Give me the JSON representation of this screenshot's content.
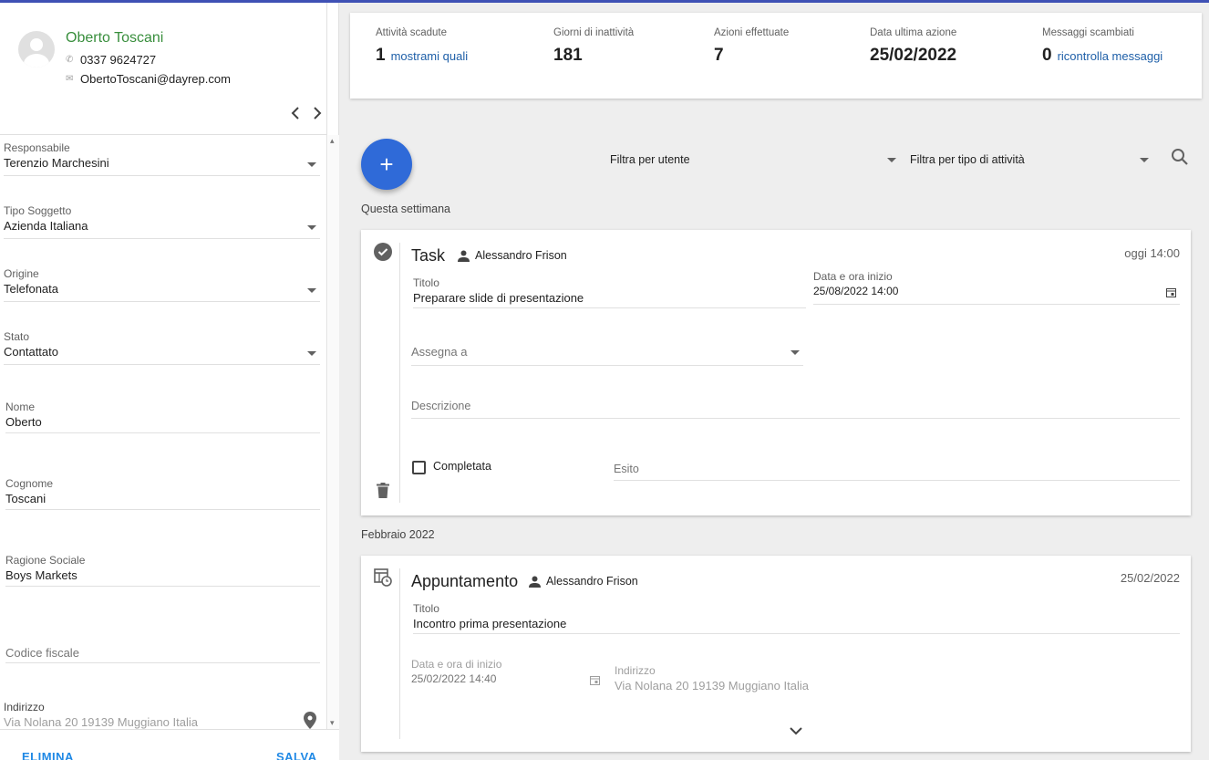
{
  "contact": {
    "name": "Oberto Toscani",
    "phone": "0337 9624727",
    "email": "ObertoToscani@dayrep.com"
  },
  "form": {
    "responsabile": {
      "label": "Responsabile",
      "value": "Terenzio Marchesini"
    },
    "tipo_soggetto": {
      "label": "Tipo Soggetto",
      "value": "Azienda Italiana"
    },
    "origine": {
      "label": "Origine",
      "value": "Telefonata"
    },
    "stato": {
      "label": "Stato",
      "value": "Contattato"
    },
    "nome": {
      "label": "Nome",
      "value": "Oberto"
    },
    "cognome": {
      "label": "Cognome",
      "value": "Toscani"
    },
    "ragione_sociale": {
      "label": "Ragione Sociale",
      "value": "Boys Markets"
    },
    "codice_fiscale": {
      "placeholder": "Codice fiscale"
    },
    "indirizzo": {
      "label": "Indirizzo",
      "value": "Via Nolana 20 19139 Muggiano Italia"
    },
    "delete_label": "ELIMINA",
    "save_label": "SALVA"
  },
  "stats": [
    {
      "label": "Attività scadute",
      "value": "1",
      "link": "mostrami quali"
    },
    {
      "label": "Giorni di inattività",
      "value": "181"
    },
    {
      "label": "Azioni effettuate",
      "value": "7"
    },
    {
      "label": "Data ultima azione",
      "value": "25/02/2022"
    },
    {
      "label": "Messaggi scambiati",
      "value": "0",
      "link": "ricontrolla messaggi"
    }
  ],
  "toolbar": {
    "filter_user": "Filtra per utente",
    "filter_type": "Filtra per tipo di attività"
  },
  "sections": {
    "this_week": "Questa settimana",
    "feb_2022": "Febbraio 2022"
  },
  "task_card": {
    "type": "Task",
    "user": "Alessandro Frison",
    "when": "oggi 14:00",
    "titolo_label": "Titolo",
    "titolo_value": "Preparare slide di presentazione",
    "start_label": "Data e ora inizio",
    "start_value": "25/08/2022 14:00",
    "assign_placeholder": "Assegna a",
    "description_placeholder": "Descrizione",
    "completed_label": "Completata",
    "outcome_placeholder": "Esito"
  },
  "appointment_card": {
    "type": "Appuntamento",
    "user": "Alessandro Frison",
    "when": "25/02/2022",
    "titolo_label": "Titolo",
    "titolo_value": "Incontro prima presentazione",
    "start_label": "Data e ora di inizio",
    "start_value": "25/02/2022 14:40",
    "address_label": "Indirizzo",
    "address_value": "Via Nolana 20 19139 Muggiano Italia"
  },
  "colors": {
    "accent": "#2f6ad8",
    "link": "#1e5fa8",
    "name_green": "#388e3c"
  }
}
